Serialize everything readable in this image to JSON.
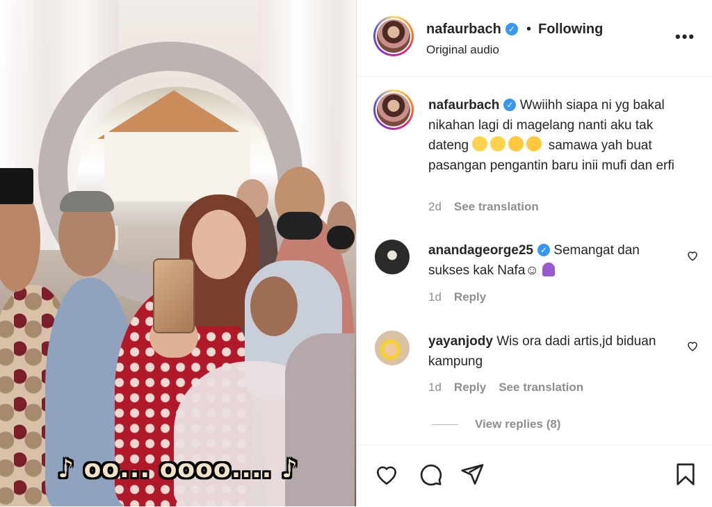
{
  "media": {
    "caption": "♪ oo... oooo.... ♪"
  },
  "header": {
    "username": "nafaurbach",
    "separator": "•",
    "follow_status": "Following",
    "audio": "Original audio",
    "more_icon": "more-horizontal-icon"
  },
  "post": {
    "username": "nafaurbach",
    "caption": "Wwiihh siapa ni yg bakal nikahan lagi di magelang nanti aku tak dateng",
    "caption_end": "samawa yah buat pasangan pengantin baru inii mufi dan erfi",
    "emojis": [
      "zany-face",
      "zany-face",
      "smiling-face",
      "smiling-face"
    ],
    "time": "2d",
    "translate": "See translation"
  },
  "comments": [
    {
      "username": "anandageorge25",
      "verified": true,
      "text": "Semangat dan sukses kak Nafa☺",
      "emoji": "person-raising-hands",
      "time": "1d",
      "reply": "Reply"
    },
    {
      "username": "yayanjody",
      "verified": false,
      "text": "Wis ora dadi artis,jd biduan kampung",
      "time": "1d",
      "reply": "Reply",
      "translate": "See translation"
    }
  ],
  "view_replies": "View replies (8)",
  "actions": {
    "like_icon": "heart-icon",
    "comment_icon": "comment-icon",
    "share_icon": "send-icon",
    "save_icon": "bookmark-icon"
  },
  "colors": {
    "text": "#262626",
    "muted": "#8e8e8e",
    "verified": "#3897f0"
  }
}
